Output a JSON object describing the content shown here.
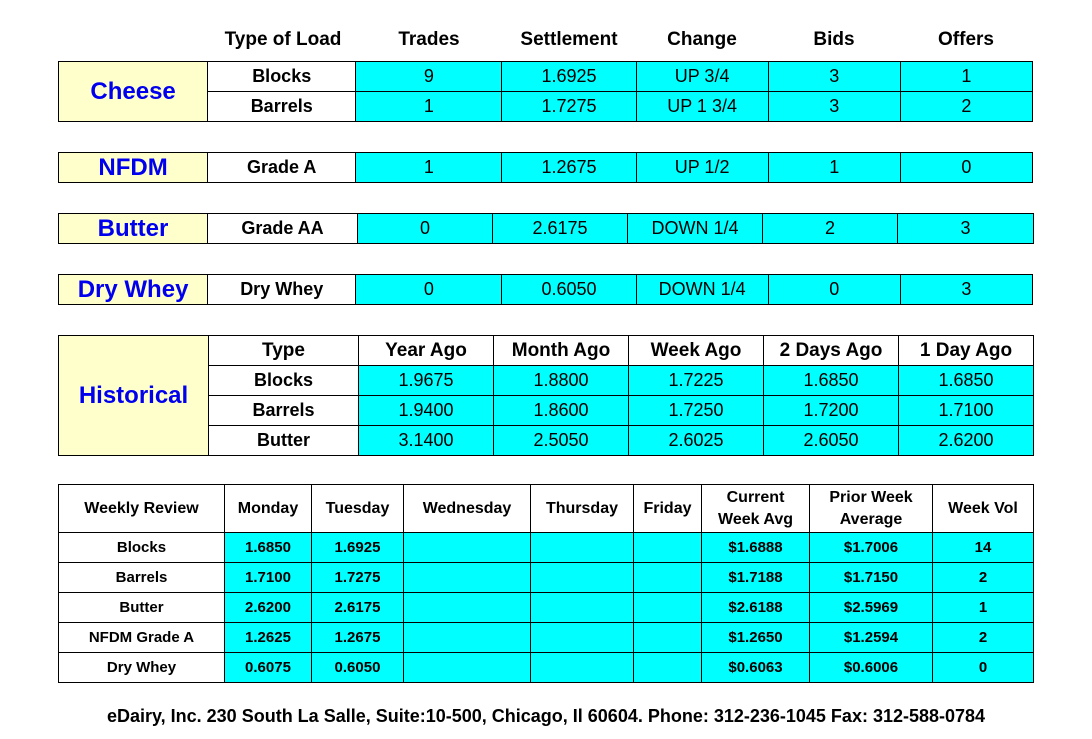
{
  "top_headers": {
    "type_of_load": "Type of Load",
    "trades": "Trades",
    "settlement": "Settlement",
    "change": "Change",
    "bids": "Bids",
    "offers": "Offers"
  },
  "cheese": {
    "label": "Cheese",
    "rows": [
      {
        "type": "Blocks",
        "trades": "9",
        "settlement": "1.6925",
        "change": "UP 3/4",
        "bids": "3",
        "offers": "1"
      },
      {
        "type": "Barrels",
        "trades": "1",
        "settlement": "1.7275",
        "change": "UP 1 3/4",
        "bids": "3",
        "offers": "2"
      }
    ]
  },
  "nfdm": {
    "label": "NFDM",
    "row": {
      "type": "Grade A",
      "trades": "1",
      "settlement": "1.2675",
      "change": "UP 1/2",
      "bids": "1",
      "offers": "0"
    }
  },
  "butter": {
    "label": "Butter",
    "row": {
      "type": "Grade AA",
      "trades": "0",
      "settlement": "2.6175",
      "change": "DOWN 1/4",
      "bids": "2",
      "offers": "3"
    }
  },
  "dry_whey": {
    "label": "Dry Whey",
    "row": {
      "type": "Dry Whey",
      "trades": "0",
      "settlement": "0.6050",
      "change": "DOWN 1/4",
      "bids": "0",
      "offers": "3"
    }
  },
  "historical": {
    "label": "Historical",
    "headers": [
      "Type",
      "Year Ago",
      "Month Ago",
      "Week Ago",
      "2 Days Ago",
      "1 Day Ago"
    ],
    "rows": [
      {
        "type": "Blocks",
        "values": [
          "1.9675",
          "1.8800",
          "1.7225",
          "1.6850",
          "1.6850"
        ]
      },
      {
        "type": "Barrels",
        "values": [
          "1.9400",
          "1.8600",
          "1.7250",
          "1.7200",
          "1.7100"
        ]
      },
      {
        "type": "Butter",
        "values": [
          "3.1400",
          "2.5050",
          "2.6025",
          "2.6050",
          "2.6200"
        ]
      }
    ]
  },
  "weekly": {
    "headers": [
      "Weekly Review",
      "Monday",
      "Tuesday",
      "Wednesday",
      "Thursday",
      "Friday",
      "Current Week Avg",
      "Prior Week Average",
      "Week Vol"
    ],
    "rows": [
      {
        "label": "Blocks",
        "monday": "1.6850",
        "tuesday": "1.6925",
        "wednesday": "",
        "thursday": "",
        "friday": "",
        "current": "$1.6888",
        "prior": "$1.7006",
        "vol": "14"
      },
      {
        "label": "Barrels",
        "monday": "1.7100",
        "tuesday": "1.7275",
        "wednesday": "",
        "thursday": "",
        "friday": "",
        "current": "$1.7188",
        "prior": "$1.7150",
        "vol": "2"
      },
      {
        "label": "Butter",
        "monday": "2.6200",
        "tuesday": "2.6175",
        "wednesday": "",
        "thursday": "",
        "friday": "",
        "current": "$2.6188",
        "prior": "$2.5969",
        "vol": "1"
      },
      {
        "label": "NFDM Grade A",
        "monday": "1.2625",
        "tuesday": "1.2675",
        "wednesday": "",
        "thursday": "",
        "friday": "",
        "current": "$1.2650",
        "prior": "$1.2594",
        "vol": "2"
      },
      {
        "label": "Dry Whey",
        "monday": "0.6075",
        "tuesday": "0.6050",
        "wednesday": "",
        "thursday": "",
        "friday": "",
        "current": "$0.6063",
        "prior": "$0.6006",
        "vol": "0"
      }
    ]
  },
  "footer": "eDairy, Inc. 230 South La Salle, Suite:10-500, Chicago, Il 60604. Phone: 312-236-1045 Fax: 312-588-0784",
  "colors": {
    "cyan": "#00ffff",
    "label_bg": "#ffffcc",
    "label_text": "#0000ee"
  }
}
